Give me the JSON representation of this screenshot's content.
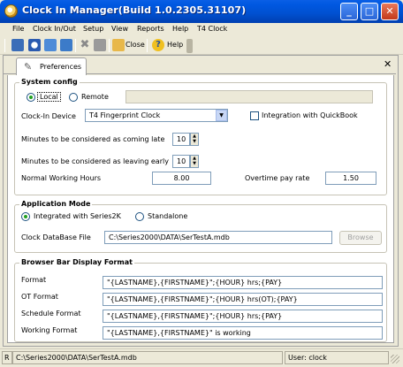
{
  "window": {
    "title": "Clock In Manager(Build 1.0.2305.31107)",
    "minimize_label": "_",
    "maximize_label": "□",
    "close_label": "✕"
  },
  "menu": [
    "File",
    "Clock In/Out",
    "Setup",
    "View",
    "Reports",
    "Help",
    "T4 Clock"
  ],
  "toolbar": {
    "close_label": "Close",
    "help_label": "Help"
  },
  "tab": {
    "label": "Preferences",
    "close_label": "✕"
  },
  "system_config": {
    "title": "System config",
    "local_label": "Local",
    "remote_label": "Remote",
    "remote_value": "",
    "clock_in_device_label": "Clock-In Device",
    "clock_in_device_value": "T4 Fingerprint Clock",
    "quickbook_label": "Integration with QuickBook",
    "late_label": "Minutes to be considered as coming late",
    "late_value": "10",
    "early_label": "Minutes to be considered as leaving early",
    "early_value": "10",
    "normal_hours_label": "Normal Working Hours",
    "normal_hours_value": "8.00",
    "overtime_label": "Overtime pay rate",
    "overtime_value": "1.50"
  },
  "application_mode": {
    "title": "Application Mode",
    "integrated_label": "Integrated with Series2K",
    "standalone_label": "Standalone",
    "db_file_label": "Clock DataBase File",
    "db_file_value": "C:\\Series2000\\DATA\\SerTestA.mdb",
    "browse_label": "Browse"
  },
  "browser_bar": {
    "title": "Browser Bar Display Format",
    "rows": [
      {
        "label": "Format",
        "value": "\"{LASTNAME},{FIRSTNAME}\";{HOUR} hrs;{PAY}"
      },
      {
        "label": "OT Format",
        "value": "\"{LASTNAME},{FIRSTNAME}\";{HOUR} hrs(OT);{PAY}"
      },
      {
        "label": "Schedule Format",
        "value": "\"{LASTNAME},{FIRSTNAME}\";{HOUR} hrs;{PAY}"
      },
      {
        "label": "Working Format",
        "value": "\"{LASTNAME},{FIRSTNAME}\" is working"
      }
    ]
  },
  "status": {
    "prefix": "R",
    "path": "C:\\Series2000\\DATA\\SerTestA.mdb",
    "user": "User: clock"
  },
  "colors": {
    "titlebar": "#0054e3",
    "window_bg": "#ece9d8",
    "panel_bg": "#ffffff"
  }
}
